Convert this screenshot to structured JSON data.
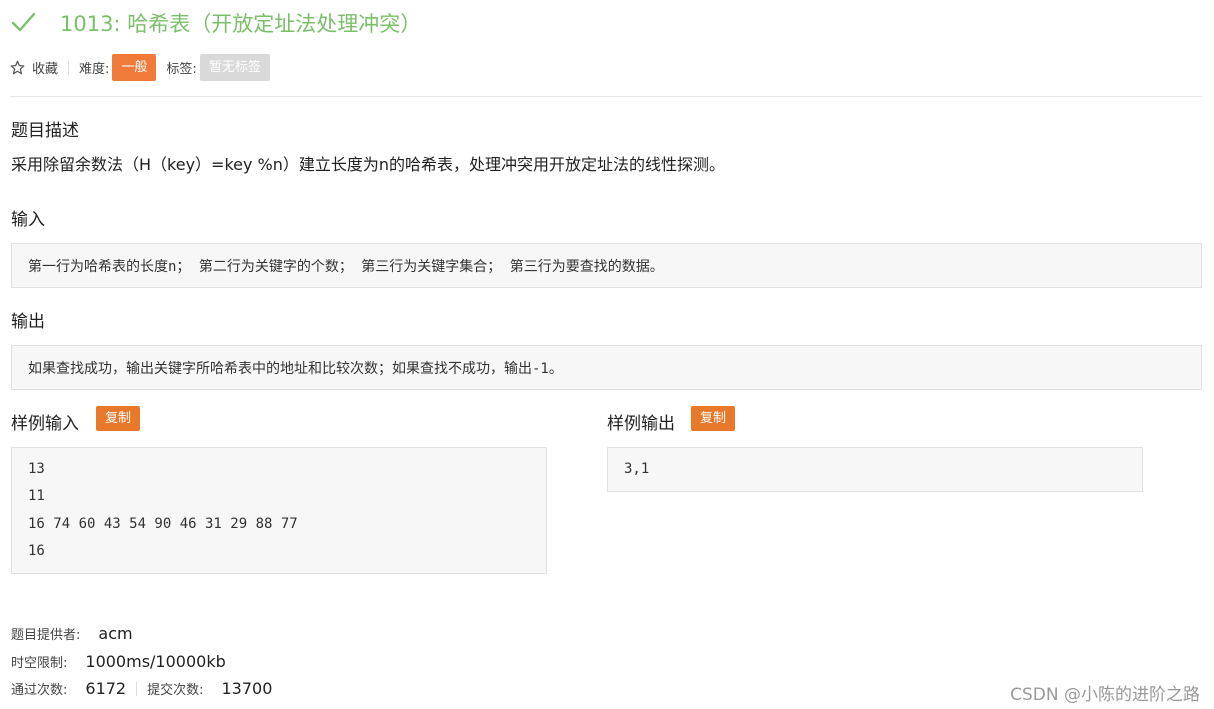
{
  "problem": {
    "title": "1013: 哈希表（开放定址法处理冲突）",
    "favorite_label": "收藏",
    "difficulty_label": "难度:",
    "difficulty_value": "一般",
    "tags_label": "标签:",
    "tags_value": "暂无标签"
  },
  "description": {
    "heading": "题目描述",
    "text": "采用除留余数法（H（key）=key %n）建立长度为n的哈希表，处理冲突用开放定址法的线性探测。"
  },
  "input": {
    "heading": "输入",
    "text": "第一行为哈希表的长度n； 第二行为关键字的个数； 第三行为关键字集合； 第三行为要查找的数据。"
  },
  "output": {
    "heading": "输出",
    "text": "如果查找成功，输出关键字所哈希表中的地址和比较次数；如果查找不成功，输出-1。"
  },
  "sample_input": {
    "heading": "样例输入",
    "copy_label": "复制",
    "lines": [
      "13",
      "11",
      "16 74 60 43 54 90 46 31 29 88 77",
      "16"
    ]
  },
  "sample_output": {
    "heading": "样例输出",
    "copy_label": "复制",
    "lines": [
      "3,1"
    ]
  },
  "info": {
    "provider_label": "题目提供者:",
    "provider_value": "acm",
    "limit_label": "时空限制:",
    "limit_value": "1000ms/10000kb",
    "passed_label": "通过次数:",
    "passed_value": "6172",
    "submitted_label": "提交次数:",
    "submitted_value": "13700"
  },
  "watermark": "CSDN @小陈的进阶之路",
  "colors": {
    "title_green": "#7bbf6a",
    "difficulty_orange": "#ef7a3a",
    "copy_orange": "#e8792a",
    "tag_gray": "#d9d9d9"
  },
  "icons": {
    "title": "check-icon",
    "favorite": "star-outline-icon"
  }
}
